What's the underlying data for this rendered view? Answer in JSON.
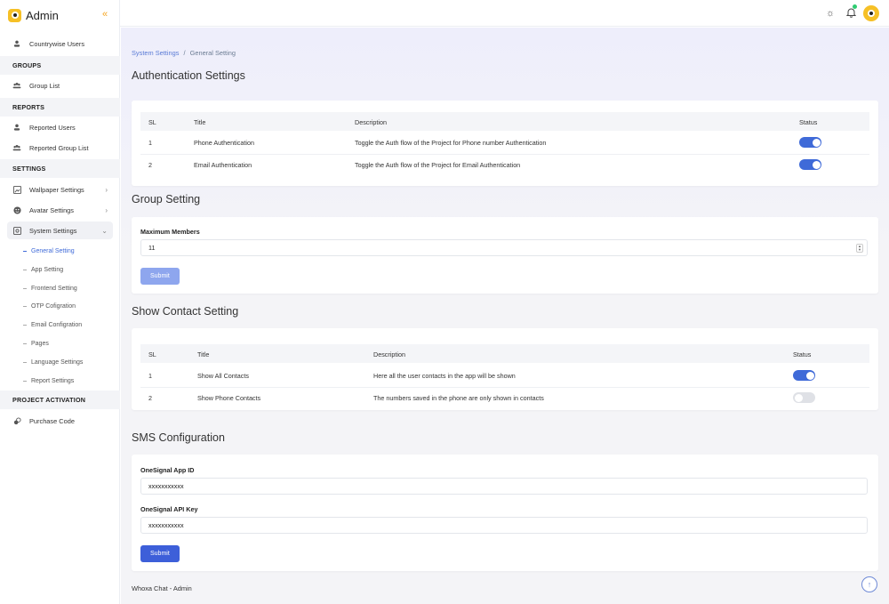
{
  "brand": {
    "title": "Admin"
  },
  "sidebar": {
    "countrywise": "Countrywise Users",
    "groups_section": "GROUPS",
    "group_list": "Group List",
    "reports_section": "REPORTS",
    "reported_users": "Reported Users",
    "reported_groups": "Reported Group List",
    "settings_section": "SETTINGS",
    "wallpaper": "Wallpaper Settings",
    "avatar": "Avatar Settings",
    "system": "System Settings",
    "sub": [
      "General Setting",
      "App Setting",
      "Frontend Setting",
      "OTP Cofigration",
      "Email Configration",
      "Pages",
      "Language Settings",
      "Report Settings"
    ],
    "project_section": "PROJECT ACTIVATION",
    "purchase": "Purchase Code"
  },
  "breadcrumb": {
    "parent": "System Settings",
    "sep": "/",
    "current": "General Setting"
  },
  "auth": {
    "title": "Authentication Settings",
    "headers": {
      "sl": "SL",
      "title": "Title",
      "desc": "Description",
      "status": "Status"
    },
    "rows": [
      {
        "sl": "1",
        "title": "Phone Authentication",
        "desc": "Toggle the Auth flow of the Project for Phone number Authentication",
        "on": true
      },
      {
        "sl": "2",
        "title": "Email Authentication",
        "desc": "Toggle the Auth flow of the Project for Email Authentication",
        "on": true
      }
    ]
  },
  "group": {
    "title": "Group Setting",
    "label": "Maximum Members",
    "value": "11",
    "submit": "Submit"
  },
  "contact": {
    "title": "Show Contact Setting",
    "headers": {
      "sl": "SL",
      "title": "Title",
      "desc": "Description",
      "status": "Status"
    },
    "rows": [
      {
        "sl": "1",
        "title": "Show All Contacts",
        "desc": "Here all the user contacts in the app will be shown",
        "on": true
      },
      {
        "sl": "2",
        "title": "Show Phone Contacts",
        "desc": "The numbers saved in the phone are only shown in contacts",
        "on": false
      }
    ]
  },
  "sms": {
    "title": "SMS Configuration",
    "app_id_label": "OneSignal App ID",
    "app_id_value": "xxxxxxxxxxx",
    "api_key_label": "OneSignal API Key",
    "api_key_value": "xxxxxxxxxxx",
    "submit": "Submit"
  },
  "footer": {
    "text": "Whoxa Chat - Admin"
  },
  "colors": {
    "accent": "#3f6ad8",
    "brand": "#f6c026"
  }
}
